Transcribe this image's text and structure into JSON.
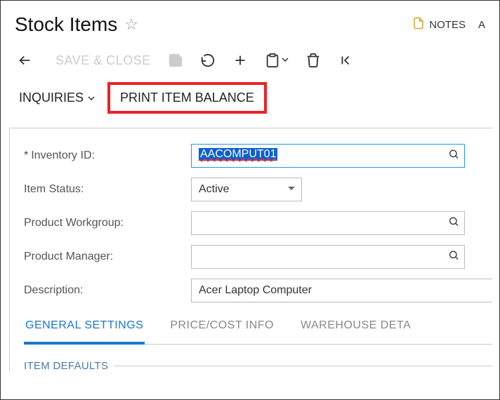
{
  "header": {
    "title": "Stock Items",
    "notes_label": "NOTES",
    "truncated": "A"
  },
  "toolbar": {
    "save_close_label": "SAVE & CLOSE"
  },
  "actions": {
    "inquiries_label": "INQUIRIES",
    "print_balance_label": "PRINT ITEM BALANCE"
  },
  "form": {
    "inventory_id": {
      "label": "Inventory ID:",
      "value": "AACOMPUT01"
    },
    "item_status": {
      "label": "Item Status:",
      "value": "Active"
    },
    "product_workgroup": {
      "label": "Product Workgroup:",
      "value": ""
    },
    "product_manager": {
      "label": "Product Manager:",
      "value": ""
    },
    "description": {
      "label": "Description:",
      "value": "Acer Laptop Computer"
    }
  },
  "tabs": {
    "general": "GENERAL SETTINGS",
    "price_cost": "PRICE/COST INFO",
    "warehouse": "WAREHOUSE DETA"
  },
  "section": {
    "item_defaults": "ITEM DEFAULTS"
  }
}
